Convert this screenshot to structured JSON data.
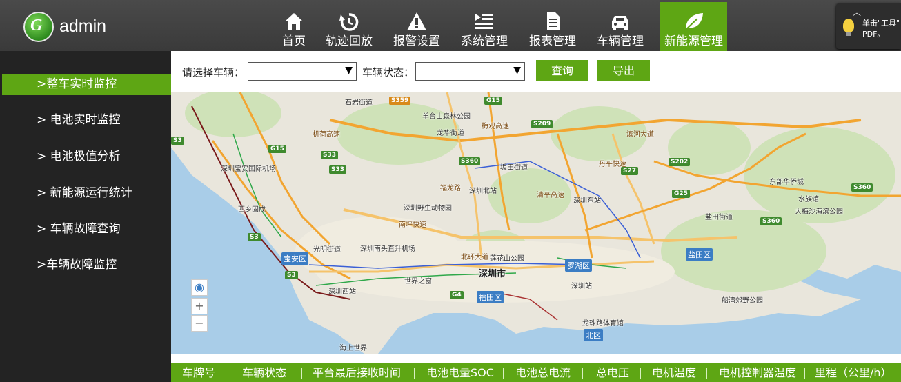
{
  "header": {
    "logo_letter": "G",
    "brand": "admin",
    "nav": [
      {
        "label": "首页",
        "icon": "home-icon"
      },
      {
        "label": "轨迹回放",
        "icon": "replay-icon"
      },
      {
        "label": "报警设置",
        "icon": "warning-icon"
      },
      {
        "label": "系统管理",
        "icon": "list-icon"
      },
      {
        "label": "报表管理",
        "icon": "document-icon"
      },
      {
        "label": "车辆管理",
        "icon": "car-icon"
      },
      {
        "label": "新能源管理",
        "icon": "leaf-icon"
      }
    ],
    "active_nav": "新能源管理",
    "tip": {
      "line1": "单击\"工具\"",
      "line2": "PDF。"
    }
  },
  "sidebar": {
    "items": [
      {
        "label": ">整车实时监控"
      },
      {
        "label": "> 电池实时监控"
      },
      {
        "label": "> 电池极值分析"
      },
      {
        "label": "> 新能源运行统计"
      },
      {
        "label": "> 车辆故障查询"
      },
      {
        "label": ">车辆故障监控"
      }
    ],
    "active_index": 0
  },
  "filter": {
    "vehicle_label": "请选择车辆：",
    "vehicle_value": "",
    "status_label": "车辆状态：",
    "status_value": "",
    "query_button": "查询",
    "export_button": "导出"
  },
  "map": {
    "places": [
      "石岩街道",
      "羊台山森林公园",
      "龙华街道",
      "坂田街道",
      "深圳北站",
      "深圳东站",
      "深圳野生动物园",
      "光明街道",
      "深圳南头直升机场",
      "深圳宝安国际机场",
      "西乡固戍",
      "世界之窗",
      "深圳西站",
      "莲花山公园",
      "深圳站",
      "东部华侨城",
      "水族馆",
      "大梅沙海滨公园",
      "盐田街道",
      "船湾郊野公园",
      "龙珠路体育馆",
      "海上世界",
      "机荷高速",
      "南坪快速",
      "北环大道",
      "福龙路",
      "梅观高速",
      "清平高速",
      "丹平快速",
      "滨河大道"
    ],
    "city_label": "深圳市",
    "districts": [
      "宝安区",
      "福田区",
      "罗湖区",
      "盐田区",
      "北区"
    ],
    "highway_shields": [
      "S359",
      "G15",
      "S209",
      "S33",
      "S33",
      "S360",
      "S27",
      "S202",
      "G25",
      "S360",
      "S360",
      "S3",
      "S3",
      "S3",
      "G4",
      "G15"
    ],
    "controls": {
      "locate": "locate-icon",
      "zoom_in": "+",
      "zoom_out": "−"
    }
  },
  "table": {
    "columns": [
      "车牌号",
      "车辆状态",
      "平台最后接收时间",
      "电池电量SOC",
      "电池总电流",
      "总电压",
      "电机温度",
      "电机控制器温度",
      "里程（公里/h）"
    ]
  },
  "colors": {
    "accent": "#5ea614",
    "header_bg": "#3f3f3f",
    "sidebar_bg": "#232323"
  }
}
